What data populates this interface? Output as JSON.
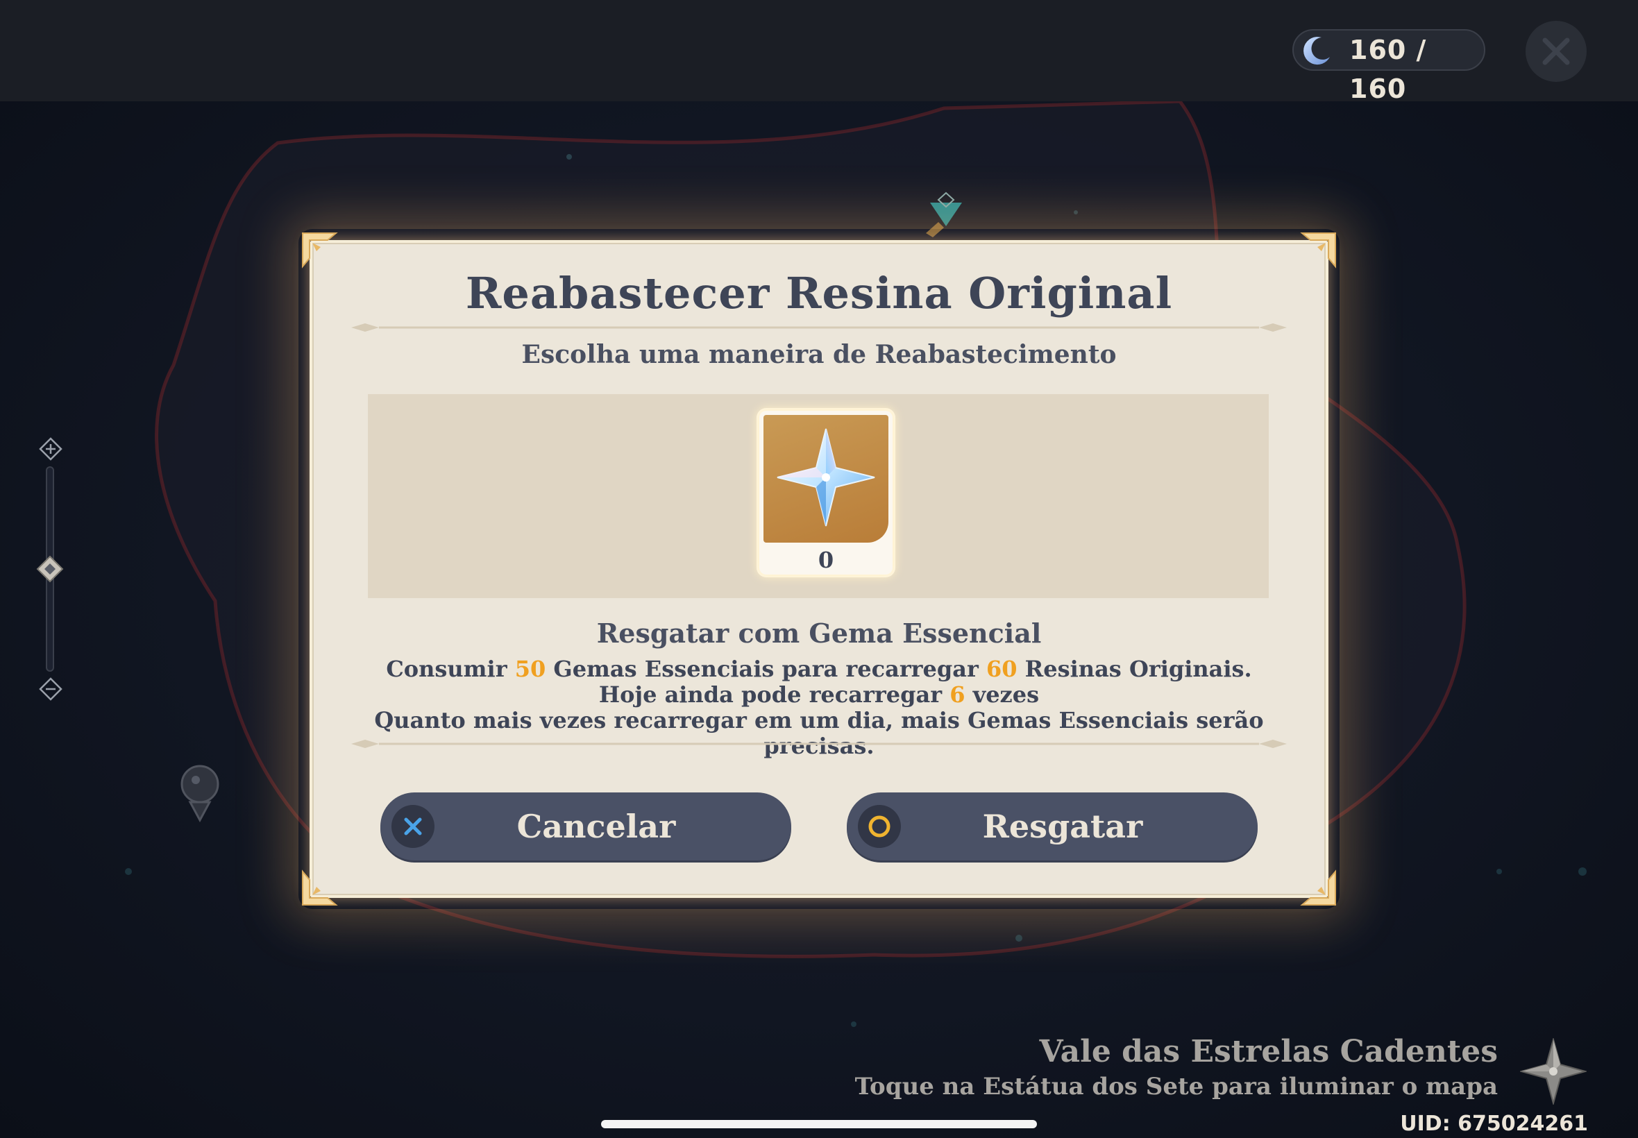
{
  "top_bar": {
    "resin_display": "160 / 160",
    "icons": {
      "resin": "crescent-moon-icon",
      "close": "close-icon"
    }
  },
  "dialog": {
    "title": "Reabastecer Resina Original",
    "subtitle": "Escolha uma maneira de Reabastecimento",
    "item": {
      "icon": "primogem-icon",
      "count": "0"
    },
    "method_title": "Resgatar com Gema Essencial",
    "description": {
      "part1": "Consumir ",
      "gems_cost": "50",
      "part2": " Gemas Essenciais para recarregar ",
      "resin_amount": "60",
      "part3": " Resinas Originais. Hoje ainda pode recarregar ",
      "recharges_left": "6",
      "part4": " vezes",
      "line2": "Quanto mais vezes recarregar em um dia, mais Gemas Essenciais serão precisas."
    },
    "buttons": {
      "cancel_label": "Cancelar",
      "redeem_label": "Resgatar"
    }
  },
  "region": {
    "name": "Vale das Estrelas Cadentes",
    "hint": "Toque na Estátua dos Sete para iluminar o mapa"
  },
  "uid": "UID: 675024261",
  "colors": {
    "highlight": "#f0a020",
    "button_bg": "#4a5166",
    "dialog_bg": "#ece6da",
    "title_text": "#3e4557"
  }
}
